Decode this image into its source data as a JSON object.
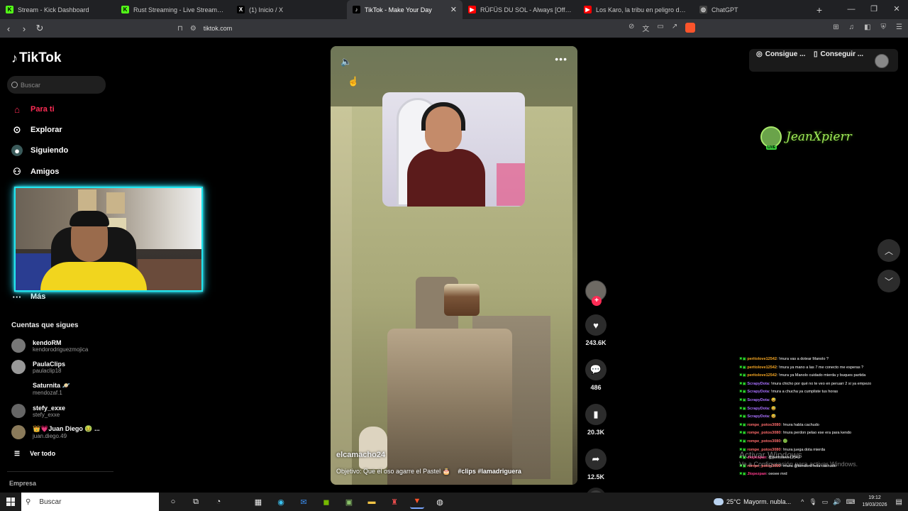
{
  "browser": {
    "tabs": [
      {
        "label": "Stream - Kick Dashboard",
        "fav_color": "#53fc18",
        "fav": "K",
        "active": false
      },
      {
        "label": "Rust Streaming - Live Streams on Ki",
        "fav_color": "#53fc18",
        "fav": "K",
        "active": false
      },
      {
        "label": "(1) Inicio / X",
        "fav_color": "#000000",
        "fav": "X",
        "active": false
      },
      {
        "label": "TikTok - Make Your Day",
        "fav_color": "#000000",
        "fav": "♪",
        "active": true
      },
      {
        "label": "RÜFÜS DU SOL - Always [Official Au",
        "fav_color": "#ff0000",
        "fav": "▶",
        "active": false
      },
      {
        "label": "Los Karo, la tribu en peligro de extin",
        "fav_color": "#ff0000",
        "fav": "▶",
        "active": false
      },
      {
        "label": "ChatGPT",
        "fav_color": "#444444",
        "fav": "◎",
        "active": false
      }
    ],
    "url": "tiktok.com"
  },
  "sidebar": {
    "logo": "TikTok",
    "search_placeholder": "Buscar",
    "nav": [
      {
        "label": "Para ti",
        "icon": "home-icon",
        "active": true
      },
      {
        "label": "Explorar",
        "icon": "compass-icon",
        "active": false
      },
      {
        "label": "Siguiendo",
        "icon": "following-icon",
        "active": false
      },
      {
        "label": "Amigos",
        "icon": "friends-icon",
        "active": false
      },
      {
        "label": "Más",
        "icon": "more-icon",
        "active": false
      }
    ],
    "following_title": "Cuentas que sigues",
    "accounts": [
      {
        "name": "kendoRM",
        "handle": "kendorodriguezmojica"
      },
      {
        "name": "PaulaClips",
        "handle": "paulaclip18"
      },
      {
        "name": "Saturnita 🪐",
        "handle": "mendozaf.1"
      },
      {
        "name": "stefy_exxe",
        "handle": "stefy_exxe"
      },
      {
        "name": "👑💗Juan Diego 🤢 ...",
        "handle": "juan.diego.49"
      }
    ],
    "see_all": "Ver todo",
    "company": "Empresa"
  },
  "video": {
    "author": "elcamacho24",
    "description": "Objetivo: Que el oso agarre el Pastel 🎂",
    "hashtags": "#clips #lamadriguera",
    "likes": "243.6K",
    "comments": "486",
    "saves": "20.3K",
    "shares": "12.5K"
  },
  "header": {
    "btn1": "Consigue ...",
    "btn2": "Conseguir ..."
  },
  "streamer": {
    "name": "JeanXpierr",
    "live": "LIVE"
  },
  "chat": [
    {
      "user": "peritolove12542",
      "user_color": "#f5a623",
      "msg": ": !mura vas a dotear Manolo ?"
    },
    {
      "user": "peritolove12542",
      "user_color": "#f5a623",
      "msg": ": !mura ya mano a las 7 me conecto me esperas ?"
    },
    {
      "user": "peritolove12542",
      "user_color": "#f5a623",
      "msg": ": !mura ya Manolo cuidado mierda y buques partida"
    },
    {
      "user": "ScrapyDota",
      "user_color": "#a970ff",
      "msg": ": !mura chicho por qué no te veo en peruarr 2 si ya empezo"
    },
    {
      "user": "ScrapyDota",
      "user_color": "#a970ff",
      "msg": ": !mura a chucha ya cumpliste tus horas"
    },
    {
      "user": "ScrapyDota",
      "user_color": "#a970ff",
      "msg": ": 😅"
    },
    {
      "user": "ScrapyDota",
      "user_color": "#a970ff",
      "msg": ": 😅"
    },
    {
      "user": "ScrapyDota",
      "user_color": "#a970ff",
      "msg": ": 😅"
    },
    {
      "user": "rompe_potos3080",
      "user_color": "#ff6b6b",
      "msg": ": !mura habla cachudo"
    },
    {
      "user": "rompe_potos3080",
      "user_color": "#ff6b6b",
      "msg": ": !mura perdon pelao ese era para kendo"
    },
    {
      "user": "rompe_potos3080",
      "user_color": "#ff6b6b",
      "msg": ": 🟢"
    },
    {
      "user": "rompe_potos3080",
      "user_color": "#ff6b6b",
      "msg": ": !mura juega dota mierda"
    },
    {
      "user": "Jlopezpan",
      "user_color": "#ff3b8d",
      "msg": ": @peritolove12542"
    },
    {
      "user": "rompe_potos3080",
      "user_color": "#ff6b6b",
      "msg": ": !mura @kendord hola cachudo"
    },
    {
      "user": "Jlopezpan",
      "user_color": "#ff3b8d",
      "msg": ": oeoee mrd"
    }
  ],
  "watermark": {
    "line1": "Activar Windows",
    "line2": "Ve a Configuración para activar Windows."
  },
  "taskbar": {
    "search": "Buscar",
    "weather_temp": "25°C",
    "weather_text": "Mayorm. nubla...",
    "time": "19:12",
    "date": "19/03/2026"
  }
}
